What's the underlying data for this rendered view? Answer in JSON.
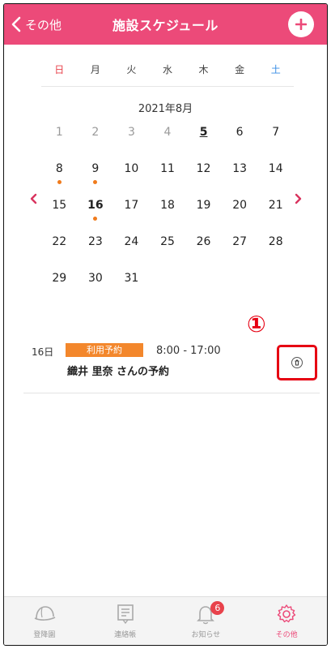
{
  "header": {
    "back_label": "その他",
    "title": "施設スケジュール",
    "color": "#ec4a79"
  },
  "calendar": {
    "weekdays": [
      "日",
      "月",
      "火",
      "水",
      "木",
      "金",
      "土"
    ],
    "month_title": "2021年8月",
    "days": [
      {
        "n": "1",
        "state": "past"
      },
      {
        "n": "2",
        "state": "past"
      },
      {
        "n": "3",
        "state": "past"
      },
      {
        "n": "4",
        "state": "past"
      },
      {
        "n": "5",
        "state": "today"
      },
      {
        "n": "6",
        "state": ""
      },
      {
        "n": "7",
        "state": ""
      },
      {
        "n": "8",
        "state": "",
        "dot": true
      },
      {
        "n": "9",
        "state": "",
        "dot": true
      },
      {
        "n": "10",
        "state": ""
      },
      {
        "n": "11",
        "state": ""
      },
      {
        "n": "12",
        "state": ""
      },
      {
        "n": "13",
        "state": ""
      },
      {
        "n": "14",
        "state": ""
      },
      {
        "n": "15",
        "state": ""
      },
      {
        "n": "16",
        "state": "bold",
        "dot": true
      },
      {
        "n": "17",
        "state": ""
      },
      {
        "n": "18",
        "state": ""
      },
      {
        "n": "19",
        "state": ""
      },
      {
        "n": "20",
        "state": ""
      },
      {
        "n": "21",
        "state": ""
      },
      {
        "n": "22",
        "state": ""
      },
      {
        "n": "23",
        "state": ""
      },
      {
        "n": "24",
        "state": ""
      },
      {
        "n": "25",
        "state": ""
      },
      {
        "n": "26",
        "state": ""
      },
      {
        "n": "27",
        "state": ""
      },
      {
        "n": "28",
        "state": ""
      },
      {
        "n": "29",
        "state": ""
      },
      {
        "n": "30",
        "state": ""
      },
      {
        "n": "31",
        "state": ""
      }
    ],
    "dot_color": "#f07b1c"
  },
  "annotation": {
    "number": "①"
  },
  "reservation": {
    "date": "16日",
    "badge": "利用予約",
    "time": "8:00 - 17:00",
    "name": "織井 里奈 さんの予約"
  },
  "tabbar": {
    "items": [
      {
        "label": "登降園",
        "icon": "helmet-icon"
      },
      {
        "label": "連絡帳",
        "icon": "notebook-icon"
      },
      {
        "label": "お知らせ",
        "icon": "bell-icon",
        "badge": "6"
      },
      {
        "label": "その他",
        "icon": "gear-icon",
        "active": true
      }
    ]
  }
}
